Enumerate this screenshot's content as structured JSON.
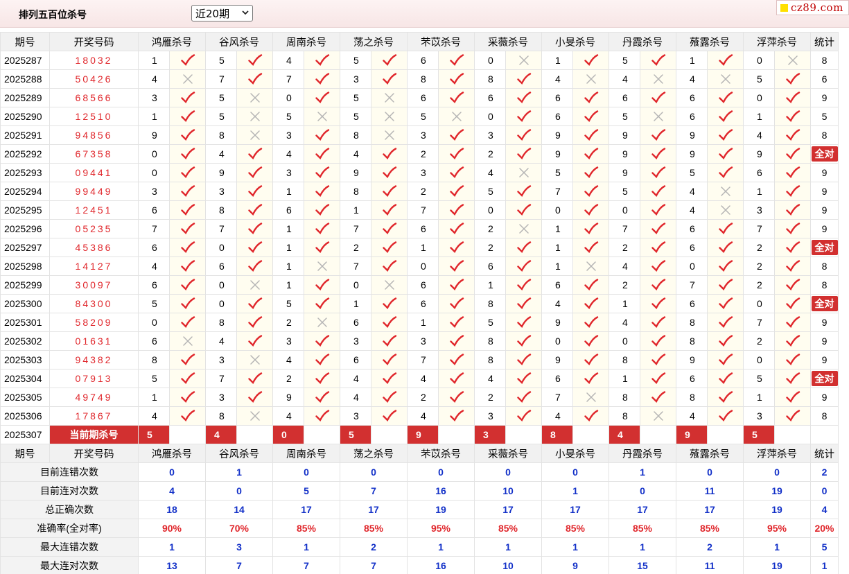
{
  "title": "排列五百位杀号",
  "period_select": {
    "value": "近20期"
  },
  "logo": {
    "text": "cz89.com"
  },
  "columns": [
    "期号",
    "开奖号码",
    "鸿雁杀号",
    "谷风杀号",
    "周南杀号",
    "荡之杀号",
    "芣苡杀号",
    "采薇杀号",
    "小旻杀号",
    "丹霞杀号",
    "蕵露杀号",
    "浮萍杀号",
    "统计"
  ],
  "rows": [
    {
      "issue": "2025287",
      "draw": "18032",
      "picks": [
        [
          "1",
          1
        ],
        [
          "5",
          1
        ],
        [
          "4",
          1
        ],
        [
          "5",
          1
        ],
        [
          "6",
          1
        ],
        [
          "0",
          0
        ],
        [
          "1",
          1
        ],
        [
          "5",
          1
        ],
        [
          "1",
          1
        ],
        [
          "0",
          0
        ]
      ],
      "stat": "8"
    },
    {
      "issue": "2025288",
      "draw": "50426",
      "picks": [
        [
          "4",
          0
        ],
        [
          "7",
          1
        ],
        [
          "7",
          1
        ],
        [
          "3",
          1
        ],
        [
          "8",
          1
        ],
        [
          "8",
          1
        ],
        [
          "4",
          0
        ],
        [
          "4",
          0
        ],
        [
          "4",
          0
        ],
        [
          "5",
          1
        ]
      ],
      "stat": "6"
    },
    {
      "issue": "2025289",
      "draw": "68566",
      "picks": [
        [
          "3",
          1
        ],
        [
          "5",
          0
        ],
        [
          "0",
          1
        ],
        [
          "5",
          0
        ],
        [
          "6",
          1
        ],
        [
          "6",
          1
        ],
        [
          "6",
          1
        ],
        [
          "6",
          1
        ],
        [
          "6",
          1
        ],
        [
          "0",
          1
        ]
      ],
      "stat": "9"
    },
    {
      "issue": "2025290",
      "draw": "12510",
      "picks": [
        [
          "1",
          1
        ],
        [
          "5",
          0
        ],
        [
          "5",
          0
        ],
        [
          "5",
          0
        ],
        [
          "5",
          0
        ],
        [
          "0",
          1
        ],
        [
          "6",
          1
        ],
        [
          "5",
          0
        ],
        [
          "6",
          1
        ],
        [
          "1",
          1
        ]
      ],
      "stat": "5"
    },
    {
      "issue": "2025291",
      "draw": "94856",
      "picks": [
        [
          "9",
          1
        ],
        [
          "8",
          0
        ],
        [
          "3",
          1
        ],
        [
          "8",
          0
        ],
        [
          "3",
          1
        ],
        [
          "3",
          1
        ],
        [
          "9",
          1
        ],
        [
          "9",
          1
        ],
        [
          "9",
          1
        ],
        [
          "4",
          1
        ]
      ],
      "stat": "8"
    },
    {
      "issue": "2025292",
      "draw": "67358",
      "picks": [
        [
          "0",
          1
        ],
        [
          "4",
          1
        ],
        [
          "4",
          1
        ],
        [
          "4",
          1
        ],
        [
          "2",
          1
        ],
        [
          "2",
          1
        ],
        [
          "9",
          1
        ],
        [
          "9",
          1
        ],
        [
          "9",
          1
        ],
        [
          "9",
          1
        ]
      ],
      "stat": "全对"
    },
    {
      "issue": "2025293",
      "draw": "09441",
      "picks": [
        [
          "0",
          1
        ],
        [
          "9",
          1
        ],
        [
          "3",
          1
        ],
        [
          "9",
          1
        ],
        [
          "3",
          1
        ],
        [
          "4",
          0
        ],
        [
          "5",
          1
        ],
        [
          "9",
          1
        ],
        [
          "5",
          1
        ],
        [
          "6",
          1
        ]
      ],
      "stat": "9"
    },
    {
      "issue": "2025294",
      "draw": "99449",
      "picks": [
        [
          "3",
          1
        ],
        [
          "3",
          1
        ],
        [
          "1",
          1
        ],
        [
          "8",
          1
        ],
        [
          "2",
          1
        ],
        [
          "5",
          1
        ],
        [
          "7",
          1
        ],
        [
          "5",
          1
        ],
        [
          "4",
          0
        ],
        [
          "1",
          1
        ]
      ],
      "stat": "9"
    },
    {
      "issue": "2025295",
      "draw": "12451",
      "picks": [
        [
          "6",
          1
        ],
        [
          "8",
          1
        ],
        [
          "6",
          1
        ],
        [
          "1",
          1
        ],
        [
          "7",
          1
        ],
        [
          "0",
          1
        ],
        [
          "0",
          1
        ],
        [
          "0",
          1
        ],
        [
          "4",
          0
        ],
        [
          "3",
          1
        ]
      ],
      "stat": "9"
    },
    {
      "issue": "2025296",
      "draw": "05235",
      "picks": [
        [
          "7",
          1
        ],
        [
          "7",
          1
        ],
        [
          "1",
          1
        ],
        [
          "7",
          1
        ],
        [
          "6",
          1
        ],
        [
          "2",
          0
        ],
        [
          "1",
          1
        ],
        [
          "7",
          1
        ],
        [
          "6",
          1
        ],
        [
          "7",
          1
        ]
      ],
      "stat": "9"
    },
    {
      "issue": "2025297",
      "draw": "45386",
      "picks": [
        [
          "6",
          1
        ],
        [
          "0",
          1
        ],
        [
          "1",
          1
        ],
        [
          "2",
          1
        ],
        [
          "1",
          1
        ],
        [
          "2",
          1
        ],
        [
          "1",
          1
        ],
        [
          "2",
          1
        ],
        [
          "6",
          1
        ],
        [
          "2",
          1
        ]
      ],
      "stat": "全对"
    },
    {
      "issue": "2025298",
      "draw": "14127",
      "picks": [
        [
          "4",
          1
        ],
        [
          "6",
          1
        ],
        [
          "1",
          0
        ],
        [
          "7",
          1
        ],
        [
          "0",
          1
        ],
        [
          "6",
          1
        ],
        [
          "1",
          0
        ],
        [
          "4",
          1
        ],
        [
          "0",
          1
        ],
        [
          "2",
          1
        ]
      ],
      "stat": "8"
    },
    {
      "issue": "2025299",
      "draw": "30097",
      "picks": [
        [
          "6",
          1
        ],
        [
          "0",
          0
        ],
        [
          "1",
          1
        ],
        [
          "0",
          0
        ],
        [
          "6",
          1
        ],
        [
          "1",
          1
        ],
        [
          "6",
          1
        ],
        [
          "2",
          1
        ],
        [
          "7",
          1
        ],
        [
          "2",
          1
        ]
      ],
      "stat": "8"
    },
    {
      "issue": "2025300",
      "draw": "84300",
      "picks": [
        [
          "5",
          1
        ],
        [
          "0",
          1
        ],
        [
          "5",
          1
        ],
        [
          "1",
          1
        ],
        [
          "6",
          1
        ],
        [
          "8",
          1
        ],
        [
          "4",
          1
        ],
        [
          "1",
          1
        ],
        [
          "6",
          1
        ],
        [
          "0",
          1
        ]
      ],
      "stat": "全对"
    },
    {
      "issue": "2025301",
      "draw": "58209",
      "picks": [
        [
          "0",
          1
        ],
        [
          "8",
          1
        ],
        [
          "2",
          0
        ],
        [
          "6",
          1
        ],
        [
          "1",
          1
        ],
        [
          "5",
          1
        ],
        [
          "9",
          1
        ],
        [
          "4",
          1
        ],
        [
          "8",
          1
        ],
        [
          "7",
          1
        ]
      ],
      "stat": "9"
    },
    {
      "issue": "2025302",
      "draw": "01631",
      "picks": [
        [
          "6",
          0
        ],
        [
          "4",
          1
        ],
        [
          "3",
          1
        ],
        [
          "3",
          1
        ],
        [
          "3",
          1
        ],
        [
          "8",
          1
        ],
        [
          "0",
          1
        ],
        [
          "0",
          1
        ],
        [
          "8",
          1
        ],
        [
          "2",
          1
        ]
      ],
      "stat": "9"
    },
    {
      "issue": "2025303",
      "draw": "94382",
      "picks": [
        [
          "8",
          1
        ],
        [
          "3",
          0
        ],
        [
          "4",
          1
        ],
        [
          "6",
          1
        ],
        [
          "7",
          1
        ],
        [
          "8",
          1
        ],
        [
          "9",
          1
        ],
        [
          "8",
          1
        ],
        [
          "9",
          1
        ],
        [
          "0",
          1
        ]
      ],
      "stat": "9"
    },
    {
      "issue": "2025304",
      "draw": "07913",
      "picks": [
        [
          "5",
          1
        ],
        [
          "7",
          1
        ],
        [
          "2",
          1
        ],
        [
          "4",
          1
        ],
        [
          "4",
          1
        ],
        [
          "4",
          1
        ],
        [
          "6",
          1
        ],
        [
          "1",
          1
        ],
        [
          "6",
          1
        ],
        [
          "5",
          1
        ]
      ],
      "stat": "全对"
    },
    {
      "issue": "2025305",
      "draw": "49749",
      "picks": [
        [
          "1",
          1
        ],
        [
          "3",
          1
        ],
        [
          "9",
          1
        ],
        [
          "4",
          1
        ],
        [
          "2",
          1
        ],
        [
          "2",
          1
        ],
        [
          "7",
          0
        ],
        [
          "8",
          1
        ],
        [
          "8",
          1
        ],
        [
          "1",
          1
        ]
      ],
      "stat": "9"
    },
    {
      "issue": "2025306",
      "draw": "17867",
      "picks": [
        [
          "4",
          1
        ],
        [
          "8",
          0
        ],
        [
          "4",
          1
        ],
        [
          "3",
          1
        ],
        [
          "4",
          1
        ],
        [
          "3",
          1
        ],
        [
          "4",
          1
        ],
        [
          "8",
          0
        ],
        [
          "4",
          1
        ],
        [
          "3",
          1
        ]
      ],
      "stat": "8"
    }
  ],
  "current": {
    "issue": "2025307",
    "label": "当前期杀号",
    "picks": [
      "5",
      "4",
      "0",
      "5",
      "9",
      "3",
      "8",
      "4",
      "9",
      "5"
    ]
  },
  "stats": [
    {
      "label": "目前连错次数",
      "values": [
        "0",
        "1",
        "0",
        "0",
        "0",
        "0",
        "0",
        "1",
        "0",
        "0",
        "2"
      ],
      "red": false
    },
    {
      "label": "目前连对次数",
      "values": [
        "4",
        "0",
        "5",
        "7",
        "16",
        "10",
        "1",
        "0",
        "11",
        "19",
        "0"
      ],
      "red": false
    },
    {
      "label": "总正确次数",
      "values": [
        "18",
        "14",
        "17",
        "17",
        "19",
        "17",
        "17",
        "17",
        "17",
        "19",
        "4"
      ],
      "red": false
    },
    {
      "label": "准确率(全对率)",
      "values": [
        "90%",
        "70%",
        "85%",
        "85%",
        "95%",
        "85%",
        "85%",
        "85%",
        "85%",
        "95%",
        "20%"
      ],
      "red": true
    },
    {
      "label": "最大连错次数",
      "values": [
        "1",
        "3",
        "1",
        "2",
        "1",
        "1",
        "1",
        "1",
        "2",
        "1",
        "5"
      ],
      "red": false
    },
    {
      "label": "最大连对次数",
      "values": [
        "13",
        "7",
        "7",
        "7",
        "16",
        "10",
        "9",
        "15",
        "11",
        "19",
        "1"
      ],
      "red": false
    }
  ],
  "icons": {
    "hit": "check-icon",
    "miss": "cross-icon"
  },
  "colors": {
    "hit_mark": "#e0262b",
    "miss_mark": "#b5b5b5",
    "draw_number": "#e0262b",
    "highlight_bg": "#d23030",
    "stat_value": "#1230c8",
    "mark_cell_bg": "#fffdf0"
  }
}
